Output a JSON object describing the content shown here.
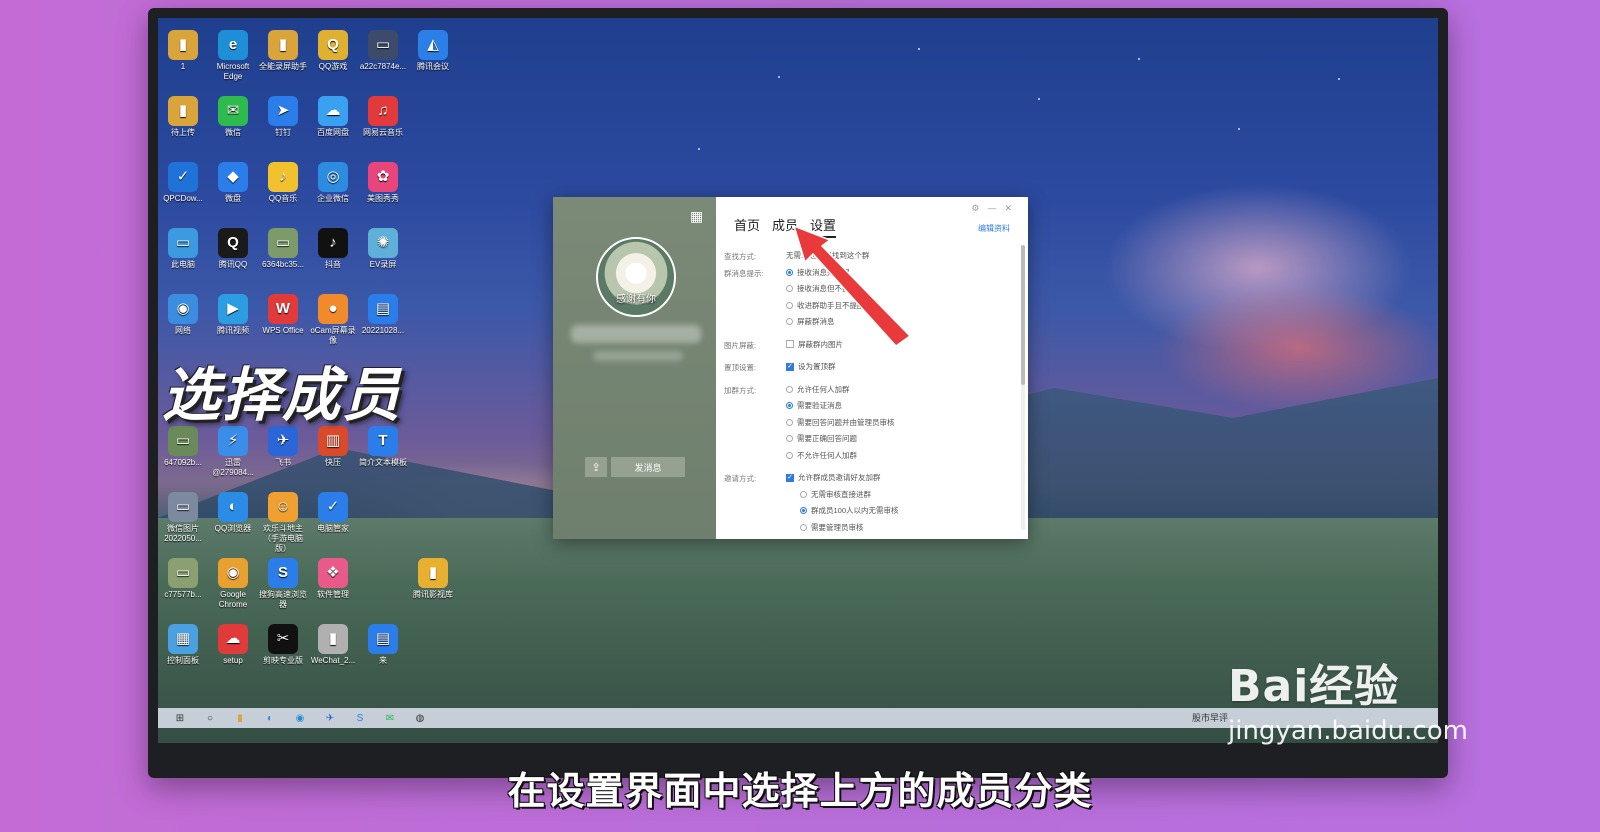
{
  "overlay": {
    "caption": "选择成员",
    "subtitle": "在设置界面中选择上方的成员分类",
    "watermark_brand": "Bai经验",
    "watermark_url": "jingyan.baidu.com"
  },
  "desktop_icons": [
    {
      "label": "1",
      "color": "#d9a43a",
      "glyph": "▮"
    },
    {
      "label": "Microsoft Edge",
      "color": "#1e8fd6",
      "glyph": "e"
    },
    {
      "label": "全能录屏助手",
      "color": "#d9a43a",
      "glyph": "▮"
    },
    {
      "label": "QQ游戏",
      "color": "#e0b030",
      "glyph": "Q"
    },
    {
      "label": "a22c7874e...",
      "color": "#3e4a6a",
      "glyph": "▭"
    },
    {
      "label": "腾讯会议",
      "color": "#2d7fe8",
      "glyph": "◭"
    },
    {
      "label": "待上传",
      "color": "#d9a43a",
      "glyph": "▮"
    },
    {
      "label": "微信",
      "color": "#2dbb4e",
      "glyph": "✉"
    },
    {
      "label": "钉钉",
      "color": "#2b7de9",
      "glyph": "➤"
    },
    {
      "label": "百度网盘",
      "color": "#3aa0f0",
      "glyph": "☁"
    },
    {
      "label": "网易云音乐",
      "color": "#e23a3a",
      "glyph": "♫"
    },
    {
      "label": "QPCDow...",
      "color": "#1f72d8",
      "glyph": "✓"
    },
    {
      "label": "微盘",
      "color": "#2b7de9",
      "glyph": "◆"
    },
    {
      "label": "QQ音乐",
      "color": "#f2c12e",
      "glyph": "♪"
    },
    {
      "label": "企业微信",
      "color": "#2b8ce0",
      "glyph": "◎"
    },
    {
      "label": "美图秀秀",
      "color": "#e8457a",
      "glyph": "✿"
    },
    {
      "label": "此电脑",
      "color": "#3b9ae0",
      "glyph": "▭"
    },
    {
      "label": "腾讯QQ",
      "color": "#1a1a1a",
      "glyph": "Q"
    },
    {
      "label": "6364bc35...",
      "color": "#7c9a6a",
      "glyph": "▭"
    },
    {
      "label": "抖音",
      "color": "#111111",
      "glyph": "♪"
    },
    {
      "label": "EV录屏",
      "color": "#5fb0d8",
      "glyph": "✺"
    },
    {
      "label": "网络",
      "color": "#3b8de0",
      "glyph": "◉"
    },
    {
      "label": "腾讯视频",
      "color": "#2b9de0",
      "glyph": "▶"
    },
    {
      "label": "WPS Office",
      "color": "#e03a3a",
      "glyph": "W"
    },
    {
      "label": "oCam屏幕录像",
      "color": "#f08a2a",
      "glyph": "●"
    },
    {
      "label": "20221028...",
      "color": "#2b7de9",
      "glyph": "▤"
    },
    {
      "label": "647092b...",
      "color": "#6a8a5a",
      "glyph": "▭"
    },
    {
      "label": "迅雷 @279084...",
      "color": "#3a8de8",
      "glyph": "⚡"
    },
    {
      "label": "飞书",
      "color": "#2a66d8",
      "glyph": "✈"
    },
    {
      "label": "快压",
      "color": "#d84a2a",
      "glyph": "▥"
    },
    {
      "label": "简介文本模板",
      "color": "#2b7de9",
      "glyph": "T"
    },
    {
      "label": "微信图片 2022050...",
      "color": "#7c8aa0",
      "glyph": "▭"
    },
    {
      "label": "QQ浏览器",
      "color": "#2b8ce8",
      "glyph": "◐"
    },
    {
      "label": "欢乐斗地主（手游电脑版）",
      "color": "#f0a030",
      "glyph": "☺"
    },
    {
      "label": "电脑管家",
      "color": "#2b7de9",
      "glyph": "✓"
    },
    {
      "label": "c77577b...",
      "color": "#8aa070",
      "glyph": "▭"
    },
    {
      "label": "Google Chrome",
      "color": "#e8a030",
      "glyph": "◉"
    },
    {
      "label": "搜狗高速浏览器",
      "color": "#2b7de9",
      "glyph": "S"
    },
    {
      "label": "软件管理",
      "color": "#e85a8a",
      "glyph": "❖"
    },
    {
      "label": "腾讯影视库",
      "color": "#e8b030",
      "glyph": "▮"
    },
    {
      "label": "控制面板",
      "color": "#4aa0e0",
      "glyph": "▦"
    },
    {
      "label": "setup",
      "color": "#e03a3a",
      "glyph": "☁"
    },
    {
      "label": "剪映专业版",
      "color": "#111111",
      "glyph": "✂"
    },
    {
      "label": "WeChat_2...",
      "color": "#b0b0b0",
      "glyph": "▮"
    },
    {
      "label": "来",
      "color": "#2b7de9",
      "glyph": "▤"
    }
  ],
  "taskbar": {
    "tray_text": "股市早评"
  },
  "qq_window": {
    "avatar_label": "感谢有你",
    "send_label": "发消息",
    "share_icon": "share-icon",
    "tabs": [
      "首页",
      "成员",
      "设置"
    ],
    "active_tab": "设置",
    "edit_link": "编辑资料",
    "settings": {
      "find_label": "查找方式:",
      "find_value": "无需... 也可以找到这个群",
      "msg_label": "群消息提示:",
      "msg_opt1": "接收消息并提醒",
      "msg_opt2": "接收消息但不提醒",
      "msg_opt3": "收进群助手且不提醒",
      "msg_opt4": "屏蔽群消息",
      "img_label": "图片屏蔽:",
      "img_opt": "屏蔽群内图片",
      "top_label": "置顶设置:",
      "top_opt": "设为置顶群",
      "join_label": "加群方式:",
      "join_opt1": "允许任何人加群",
      "join_opt2": "需要验证消息",
      "join_opt3": "需要回答问题并由管理员审核",
      "join_opt4": "需要正确回答问题",
      "join_opt5": "不允许任何人加群",
      "invite_label": "邀请方式:",
      "invite_opt": "允许群成员邀请好友加群",
      "invite_sub1": "无需审核直接进群",
      "invite_sub2": "群成员100人以内无需审核",
      "invite_sub3": "需要管理员审核"
    }
  },
  "colors": {
    "accent": "#2f7ce0",
    "arrow": "#e83a3a"
  }
}
